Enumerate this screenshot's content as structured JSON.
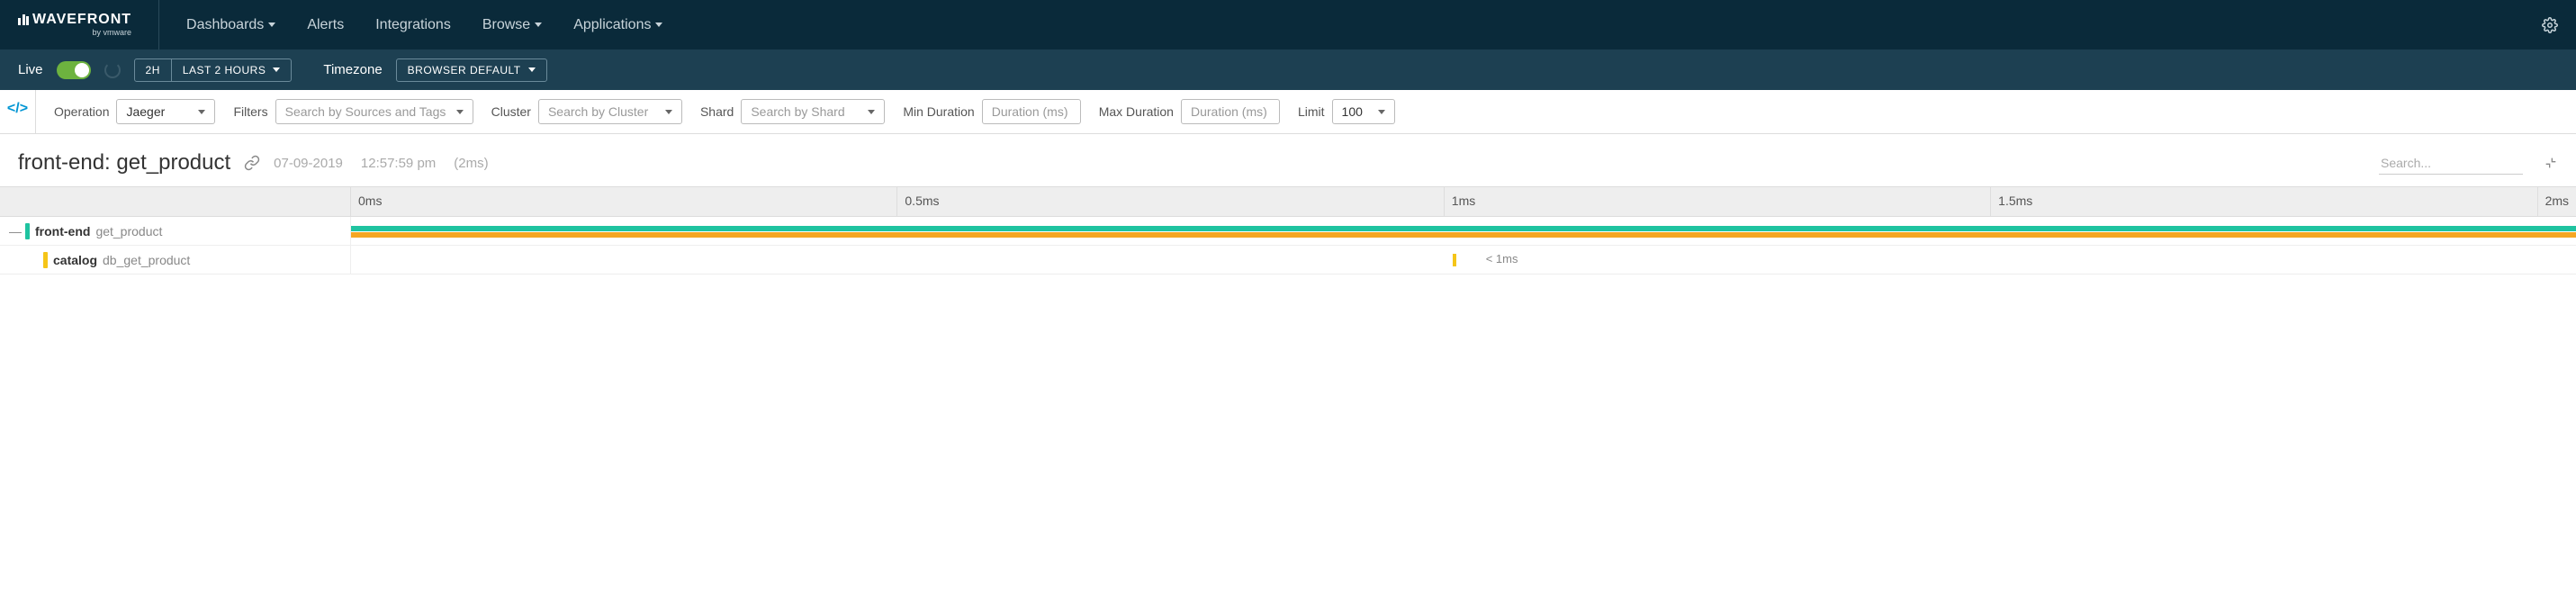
{
  "brand": {
    "name": "WAVEFRONT",
    "by": "by vmware"
  },
  "nav": {
    "dashboards": "Dashboards",
    "alerts": "Alerts",
    "integrations": "Integrations",
    "browse": "Browse",
    "applications": "Applications"
  },
  "subnav": {
    "live": "Live",
    "time_preset": "2H",
    "time_range": "LAST 2 HOURS",
    "timezone_label": "Timezone",
    "timezone_value": "BROWSER DEFAULT"
  },
  "filters": {
    "operation_label": "Operation",
    "operation_value": "Jaeger",
    "filters_label": "Filters",
    "filters_placeholder": "Search by Sources and Tags",
    "cluster_label": "Cluster",
    "cluster_placeholder": "Search by Cluster",
    "shard_label": "Shard",
    "shard_placeholder": "Search by Shard",
    "min_duration_label": "Min Duration",
    "min_duration_placeholder": "Duration (ms)",
    "max_duration_label": "Max Duration",
    "max_duration_placeholder": "Duration (ms)",
    "limit_label": "Limit",
    "limit_value": "100"
  },
  "trace": {
    "title": "front-end: get_product",
    "date": "07-09-2019",
    "time": "12:57:59 pm",
    "duration": "(2ms)",
    "search_placeholder": "Search..."
  },
  "timeline": {
    "ticks": [
      "0ms",
      "0.5ms",
      "1ms",
      "1.5ms",
      "2ms"
    ]
  },
  "spans": [
    {
      "service": "front-end",
      "operation": "get_product",
      "color": "#1fc3a0",
      "expandable": true,
      "indent": 0
    },
    {
      "service": "catalog",
      "operation": "db_get_product",
      "color": "#f5c518",
      "expandable": false,
      "indent": 1,
      "duration_label": "< 1ms"
    }
  ]
}
